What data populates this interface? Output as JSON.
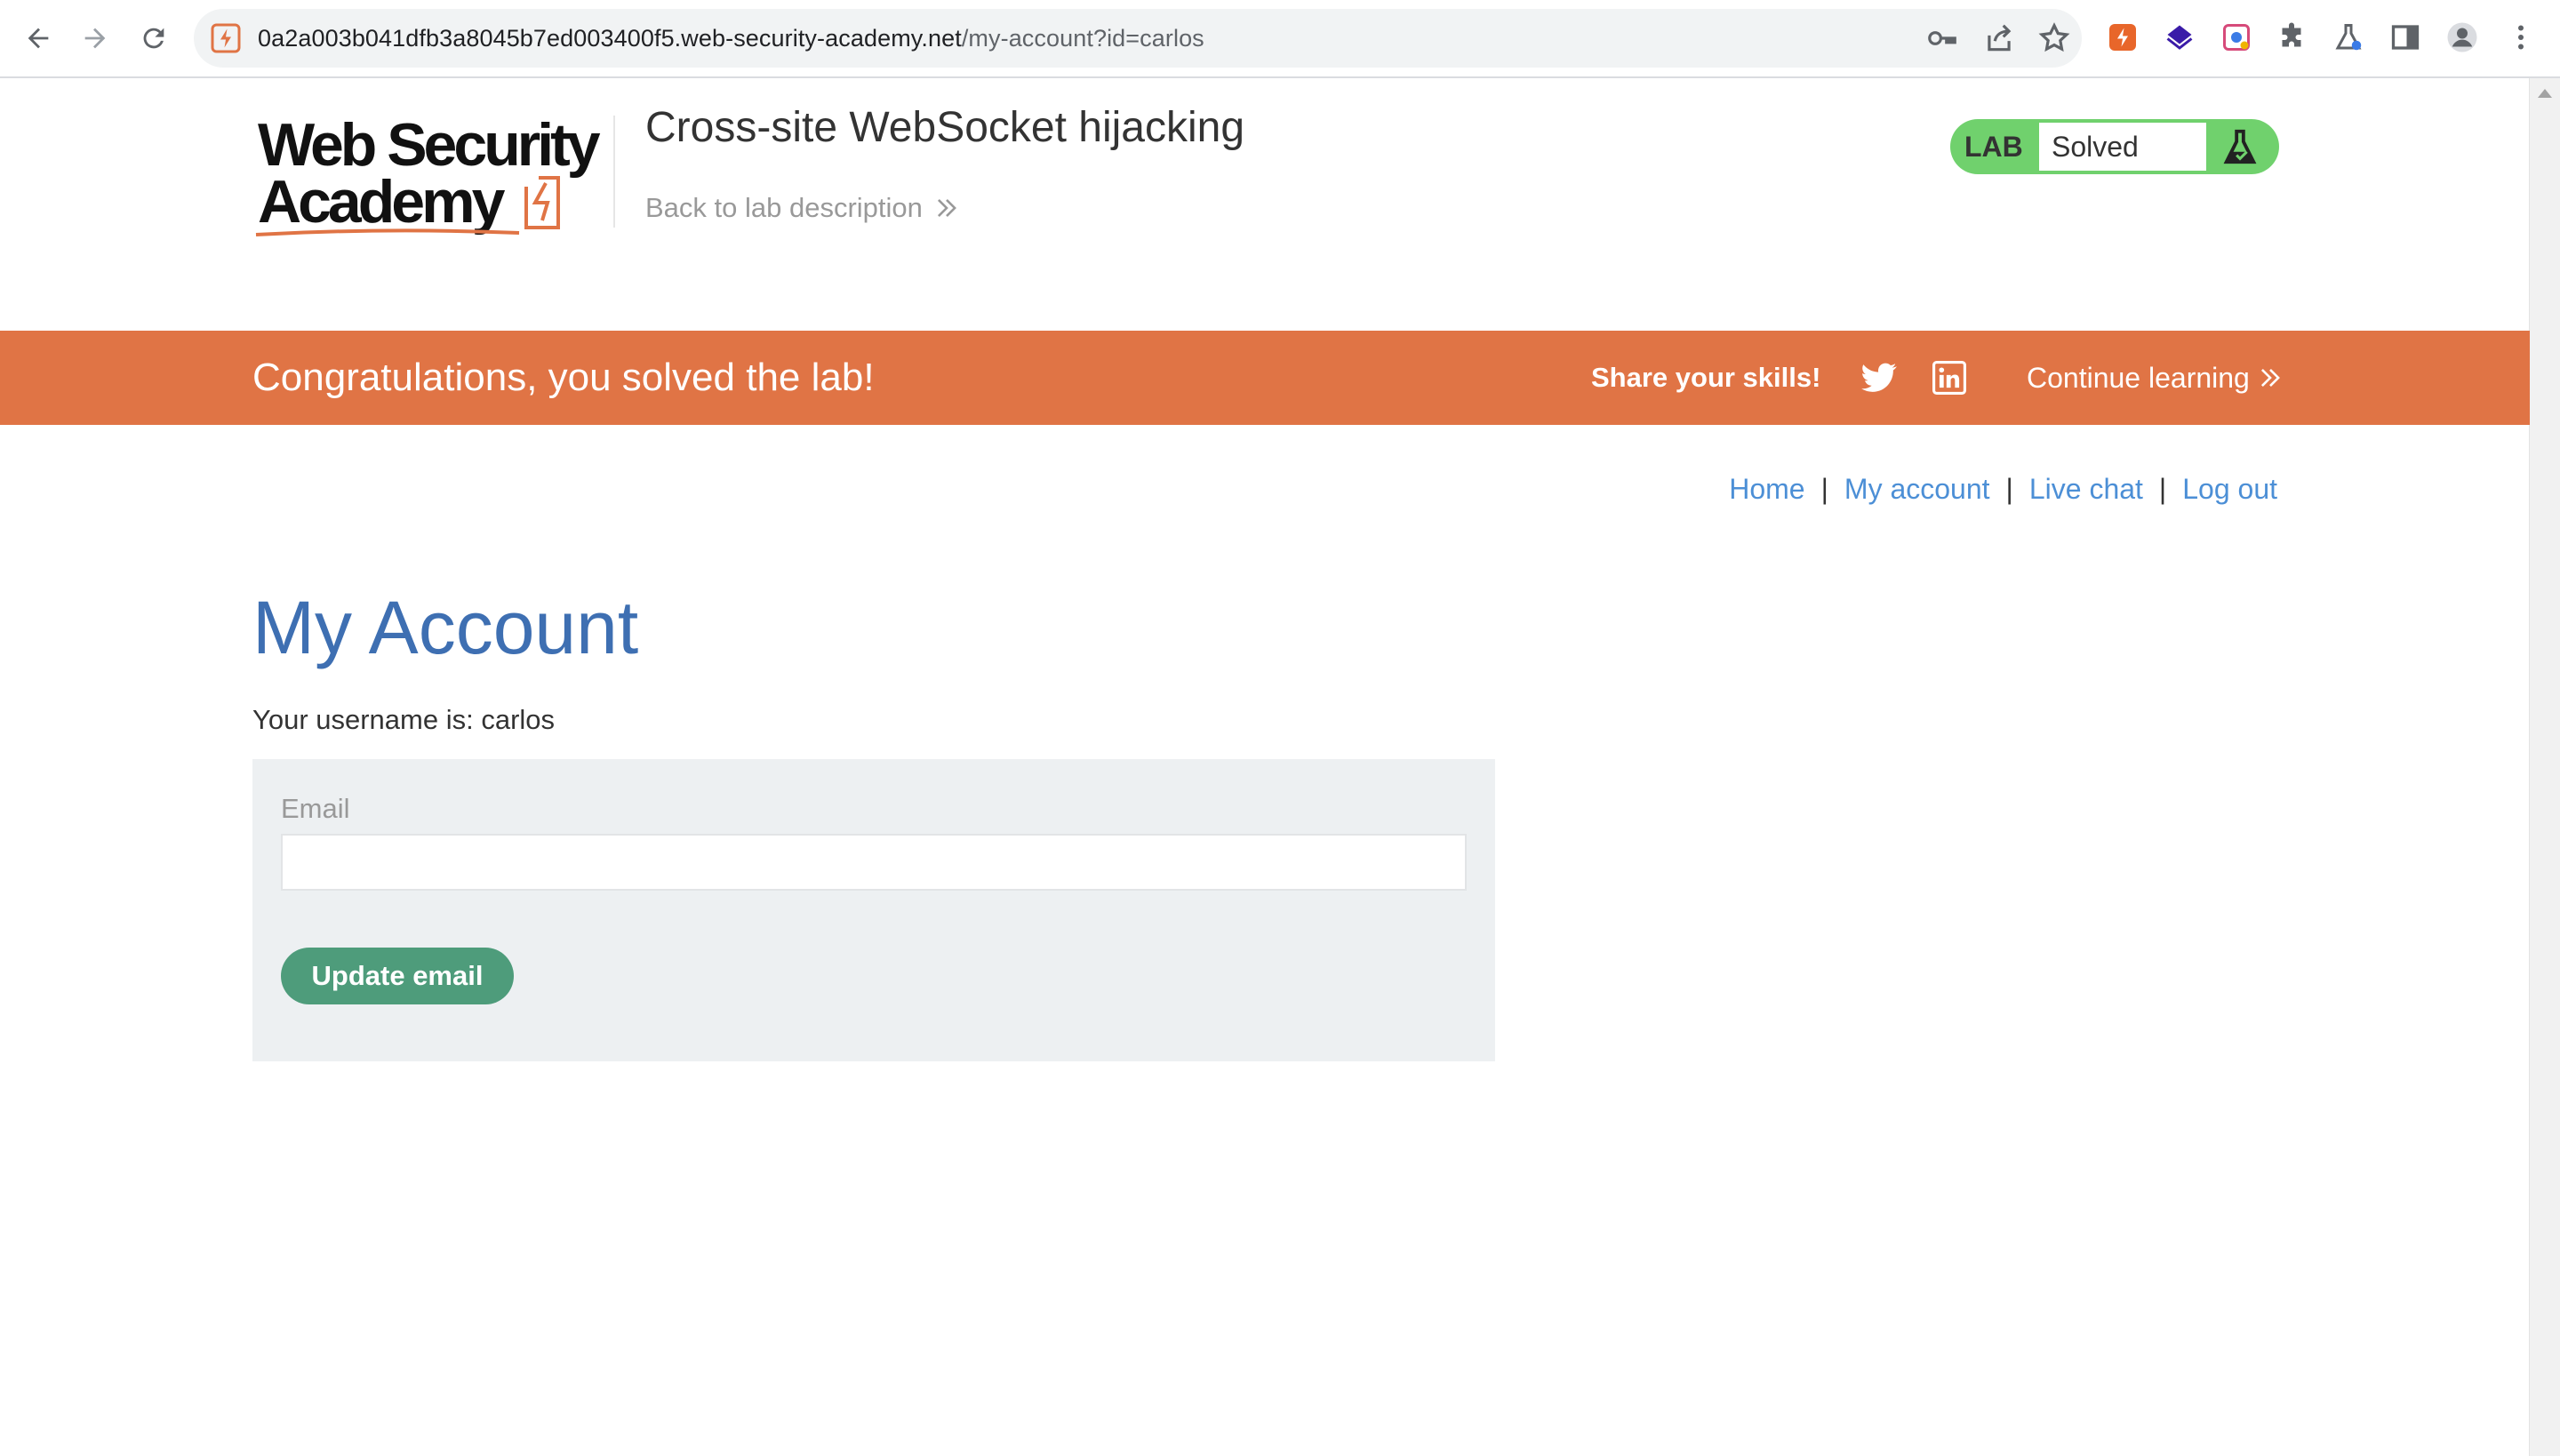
{
  "browser": {
    "url_host": "0a2a003b041dfb3a8045b7ed003400f5.web-security-academy.net",
    "url_path": "/my-account?id=carlos",
    "icons": [
      "back-icon",
      "forward-icon",
      "reload-icon",
      "key-icon",
      "share-icon",
      "star-icon",
      "burp-extension-icon",
      "layers-extension-icon",
      "screenshot-extension-icon",
      "puzzle-icon",
      "flask-extension-icon",
      "sidepanel-icon",
      "profile-icon",
      "menu-icon"
    ]
  },
  "header": {
    "logo_line1": "Web Security",
    "logo_line2": "Academy",
    "lab_title": "Cross-site WebSocket hijacking",
    "back_link": "Back to lab description",
    "badge_label": "LAB",
    "badge_status": "Solved"
  },
  "banner": {
    "message": "Congratulations, you solved the lab!",
    "share_label": "Share your skills!",
    "continue_label": "Continue learning"
  },
  "nav": {
    "home": "Home",
    "my_account": "My account",
    "live_chat": "Live chat",
    "log_out": "Log out",
    "separator": "|"
  },
  "main": {
    "title": "My Account",
    "username_text": "Your username is: carlos",
    "email_label": "Email",
    "email_value": "",
    "update_button": "Update email"
  },
  "colors": {
    "accent_orange": "#e07445",
    "title_blue": "#3e6fb2",
    "link_blue": "#4c8fd6",
    "badge_green": "#70d16d",
    "button_green": "#4e9c7b",
    "form_bg": "#edf0f2"
  }
}
